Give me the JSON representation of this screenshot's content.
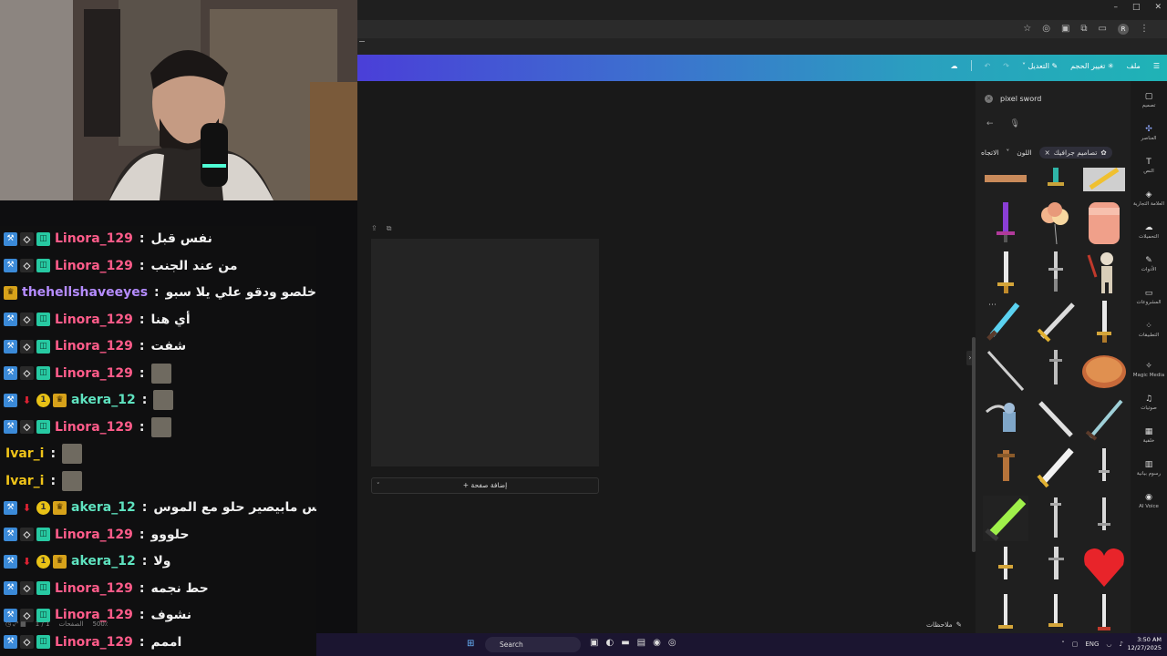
{
  "browser": {
    "window_controls": [
      "–",
      "□",
      "✕"
    ],
    "toolbar_icons": [
      "star-icon",
      "eye-icon",
      "extension-icon",
      "puzzle-icon",
      "split-icon"
    ],
    "profile_initial": "R"
  },
  "canva_header": {
    "menu_label": "ملف",
    "resize_label": "تغيير الحجم",
    "edit_label": "التعديل"
  },
  "editor": {
    "add_page_label": "+ إضافة صفحة",
    "notes_label": "ملاحظات"
  },
  "side_panel": {
    "search_value": "pixel sword",
    "filter_chip_label": "تصاميم جرافيك",
    "color_filter_label": "اللون",
    "direction_filter_label": "الاتجاه"
  },
  "right_nav": [
    {
      "icon": "design-icon",
      "label": "تصميم",
      "active": false
    },
    {
      "icon": "elements-icon",
      "label": "العناصر",
      "active": true
    },
    {
      "icon": "text-icon",
      "label": "النص",
      "active": false
    },
    {
      "icon": "brand-icon",
      "label": "العلامة التجارية",
      "active": false
    },
    {
      "icon": "uploads-icon",
      "label": "التحميلات",
      "active": false
    },
    {
      "icon": "tools-icon",
      "label": "الأدوات",
      "active": false
    },
    {
      "icon": "projects-icon",
      "label": "المشروعات",
      "active": false
    },
    {
      "icon": "apps-icon",
      "label": "التطبيقات",
      "active": false
    },
    {
      "icon": "magic-media-icon",
      "label": "Magic Media",
      "active": false
    },
    {
      "icon": "audio-icon",
      "label": "صوتيات",
      "active": false
    },
    {
      "icon": "background-icon",
      "label": "خلفية",
      "active": false
    },
    {
      "icon": "charts-icon",
      "label": "رسوم بيانية",
      "active": false
    },
    {
      "icon": "ai-voice-icon",
      "label": "AI Voice",
      "active": false
    }
  ],
  "chat": {
    "messages": [
      {
        "user": "Linora_129",
        "color": "#ff5c8a",
        "badges": [
          "mod",
          "vip",
          "sub"
        ],
        "text": "نفس قبل",
        "emote": false
      },
      {
        "user": "Linora_129",
        "color": "#ff5c8a",
        "badges": [
          "mod",
          "vip",
          "sub"
        ],
        "text": "من عند الجنب",
        "emote": false
      },
      {
        "user": "thehellshaveeyes",
        "color": "#b58cff",
        "badges": [
          "crown"
        ],
        "text": "خلصو ودقو علي يلا سبو",
        "emote": false
      },
      {
        "user": "Linora_129",
        "color": "#ff5c8a",
        "badges": [
          "mod",
          "vip",
          "sub"
        ],
        "text": "أي هنا",
        "emote": false
      },
      {
        "user": "Linora_129",
        "color": "#ff5c8a",
        "badges": [
          "mod",
          "vip",
          "sub"
        ],
        "text": "شفت",
        "emote": false
      },
      {
        "user": "Linora_129",
        "color": "#ff5c8a",
        "badges": [
          "mod",
          "vip",
          "sub"
        ],
        "text": "",
        "emote": true
      },
      {
        "user": "akera_12",
        "color": "#5fe3c0",
        "badges": [
          "mod",
          "down",
          "one",
          "crown"
        ],
        "text": "",
        "emote": true
      },
      {
        "user": "Linora_129",
        "color": "#ff5c8a",
        "badges": [
          "mod",
          "vip",
          "sub"
        ],
        "text": "",
        "emote": true
      },
      {
        "user": "Ivar_i",
        "color": "#f0c419",
        "badges": [],
        "text": "",
        "emote": true
      },
      {
        "user": "Ivar_i",
        "color": "#f0c419",
        "badges": [],
        "text": "",
        "emote": true
      },
      {
        "user": "akera_12",
        "color": "#5fe3c0",
        "badges": [
          "mod",
          "down",
          "one",
          "crown"
        ],
        "text": "احس مابيصير حلو مع الموس",
        "emote": false
      },
      {
        "user": "Linora_129",
        "color": "#ff5c8a",
        "badges": [
          "mod",
          "vip",
          "sub"
        ],
        "text": "حلووو",
        "emote": false
      },
      {
        "user": "akera_12",
        "color": "#5fe3c0",
        "badges": [
          "mod",
          "down",
          "one",
          "crown"
        ],
        "text": "ولا",
        "emote": false
      },
      {
        "user": "Linora_129",
        "color": "#ff5c8a",
        "badges": [
          "mod",
          "vip",
          "sub"
        ],
        "text": "حط نجمه",
        "emote": false
      },
      {
        "user": "Linora_129",
        "color": "#ff5c8a",
        "badges": [
          "mod",
          "vip",
          "sub"
        ],
        "text": "نشوف",
        "emote": false
      },
      {
        "user": "Linora_129",
        "color": "#ff5c8a",
        "badges": [
          "mod",
          "vip",
          "sub"
        ],
        "text": "اممم",
        "emote": false
      }
    ]
  },
  "status_bar": {
    "pages": "1 / 1",
    "pages_label": "الصفحات",
    "zoom": "500٪"
  },
  "taskbar": {
    "search_label": "Search",
    "lang": "ENG",
    "time": "3:50 AM",
    "date": "12/27/2025"
  }
}
